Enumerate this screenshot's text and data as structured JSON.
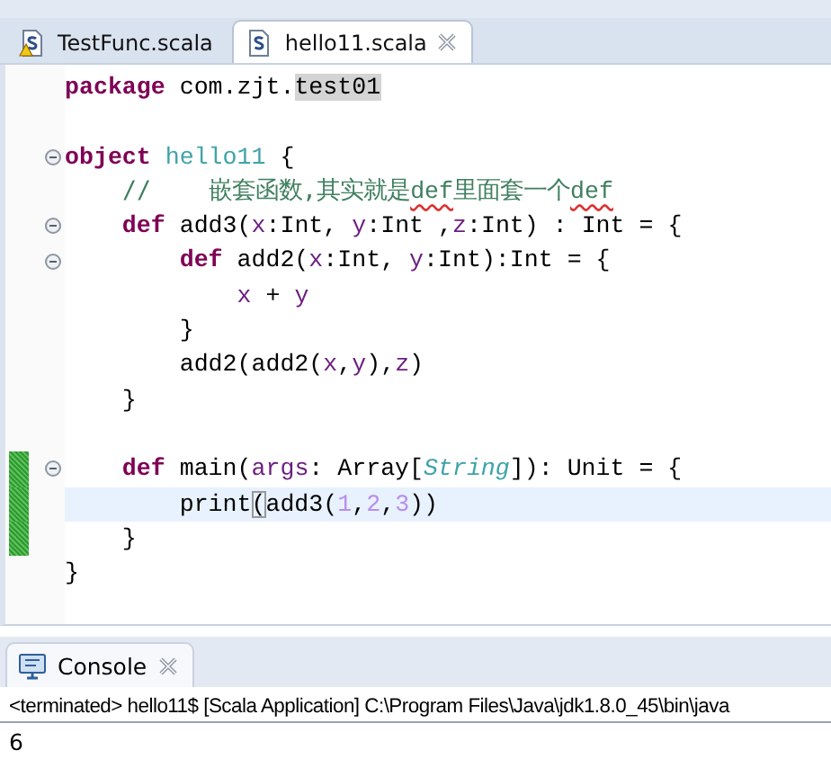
{
  "editor_tabs": [
    {
      "label": "TestFunc.scala",
      "selected": false,
      "warning": true
    },
    {
      "label": "hello11.scala",
      "selected": true,
      "warning": false
    }
  ],
  "code_lines": [
    {
      "kind": "code",
      "fold": false,
      "changed": false,
      "current": false,
      "tokens": [
        {
          "kind": "kw",
          "text": "package"
        },
        {
          "kind": "plain",
          "text": " com.zjt."
        },
        {
          "kind": "occurrence",
          "text": "test01"
        }
      ]
    },
    {
      "kind": "blank"
    },
    {
      "kind": "code",
      "fold": true,
      "changed": false,
      "current": false,
      "tokens": [
        {
          "kind": "kw",
          "text": "object"
        },
        {
          "kind": "obj",
          "text": " hello11"
        },
        {
          "kind": "plain",
          "text": " {"
        }
      ]
    },
    {
      "kind": "code",
      "fold": false,
      "changed": false,
      "current": false,
      "tokens": [
        {
          "kind": "comment",
          "text": "    //    嵌套函数,其实就是"
        },
        {
          "kind": "comment_flagged",
          "text": "def"
        },
        {
          "kind": "comment",
          "text": "里面套一个"
        },
        {
          "kind": "comment_flagged",
          "text": "def"
        }
      ]
    },
    {
      "kind": "code",
      "fold": true,
      "changed": false,
      "current": false,
      "tokens": [
        {
          "kind": "kw",
          "text": "    def"
        },
        {
          "kind": "plain",
          "text": " add3("
        },
        {
          "kind": "param",
          "text": "x"
        },
        {
          "kind": "plain",
          "text": ":Int, "
        },
        {
          "kind": "param",
          "text": "y"
        },
        {
          "kind": "plain",
          "text": ":Int ,"
        },
        {
          "kind": "param",
          "text": "z"
        },
        {
          "kind": "plain",
          "text": ":Int) : Int = {"
        }
      ]
    },
    {
      "kind": "code",
      "fold": true,
      "changed": false,
      "current": false,
      "tokens": [
        {
          "kind": "kw",
          "text": "        def"
        },
        {
          "kind": "plain",
          "text": " add2("
        },
        {
          "kind": "param",
          "text": "x"
        },
        {
          "kind": "plain",
          "text": ":Int, "
        },
        {
          "kind": "param",
          "text": "y"
        },
        {
          "kind": "plain",
          "text": ":Int):Int = {"
        }
      ]
    },
    {
      "kind": "code",
      "fold": false,
      "changed": false,
      "current": false,
      "tokens": [
        {
          "kind": "param",
          "text": "            x"
        },
        {
          "kind": "plain",
          "text": " + "
        },
        {
          "kind": "param",
          "text": "y"
        }
      ]
    },
    {
      "kind": "code",
      "fold": false,
      "changed": false,
      "current": false,
      "tokens": [
        {
          "kind": "plain",
          "text": "        }"
        }
      ]
    },
    {
      "kind": "code",
      "fold": false,
      "changed": false,
      "current": false,
      "tokens": [
        {
          "kind": "plain",
          "text": "        add2(add2("
        },
        {
          "kind": "param",
          "text": "x"
        },
        {
          "kind": "plain",
          "text": ","
        },
        {
          "kind": "param",
          "text": "y"
        },
        {
          "kind": "plain",
          "text": "),"
        },
        {
          "kind": "param",
          "text": "z"
        },
        {
          "kind": "plain",
          "text": ")"
        }
      ]
    },
    {
      "kind": "code",
      "fold": false,
      "changed": false,
      "current": false,
      "tokens": [
        {
          "kind": "plain",
          "text": "    }"
        }
      ]
    },
    {
      "kind": "blank"
    },
    {
      "kind": "code",
      "fold": true,
      "changed": true,
      "current": false,
      "tokens": [
        {
          "kind": "kw",
          "text": "    def"
        },
        {
          "kind": "plain",
          "text": " main("
        },
        {
          "kind": "param",
          "text": "args"
        },
        {
          "kind": "plain",
          "text": ": Array["
        },
        {
          "kind": "type_italic",
          "text": "String"
        },
        {
          "kind": "plain",
          "text": "]): Unit = {"
        }
      ]
    },
    {
      "kind": "code",
      "fold": false,
      "changed": true,
      "current": true,
      "tokens": [
        {
          "kind": "plain",
          "text": "        print"
        },
        {
          "kind": "bracket",
          "text": "("
        },
        {
          "kind": "plain",
          "text": "add3("
        },
        {
          "kind": "num",
          "text": "1"
        },
        {
          "kind": "plain",
          "text": ","
        },
        {
          "kind": "num",
          "text": "2"
        },
        {
          "kind": "plain",
          "text": ","
        },
        {
          "kind": "num",
          "text": "3"
        },
        {
          "kind": "plain",
          "text": "))"
        }
      ]
    },
    {
      "kind": "code",
      "fold": false,
      "changed": true,
      "current": false,
      "tokens": [
        {
          "kind": "plain",
          "text": "    }"
        }
      ]
    },
    {
      "kind": "code",
      "fold": false,
      "changed": false,
      "current": false,
      "tokens": [
        {
          "kind": "plain",
          "text": "}"
        }
      ]
    }
  ],
  "console": {
    "tab": {
      "label": "Console",
      "selected": true
    },
    "status": "<terminated> hello11$ [Scala Application] C:\\Program Files\\Java\\jdk1.8.0_45\\bin\\java",
    "output": "6"
  }
}
